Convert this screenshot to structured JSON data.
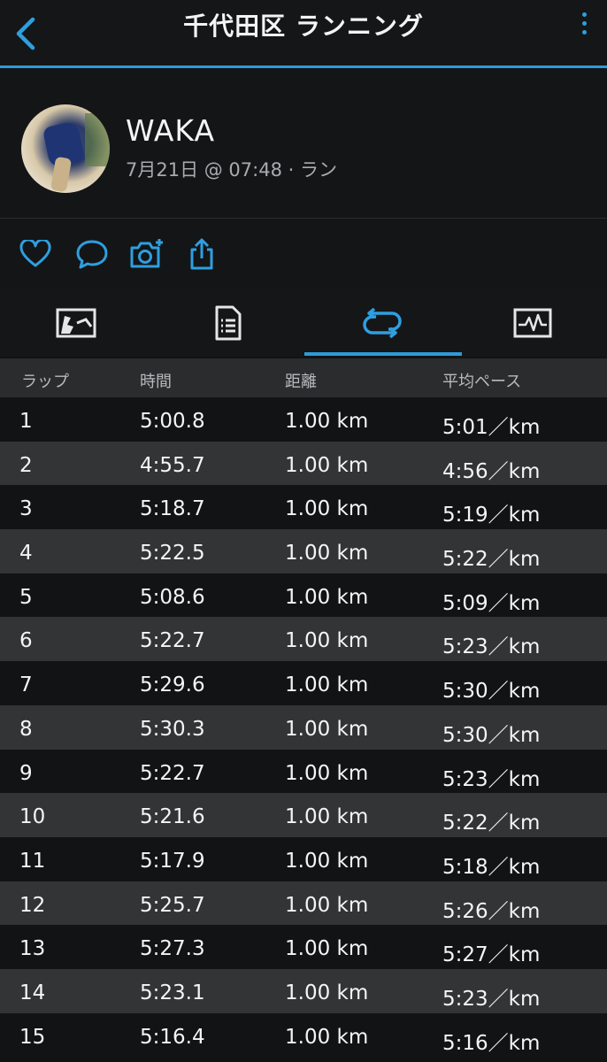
{
  "header": {
    "title": "千代田区 ランニング"
  },
  "profile": {
    "name": "WAKA",
    "meta": "7月21日 @ 07:48 · ラン"
  },
  "table": {
    "headers": {
      "lap": "ラップ",
      "time": "時間",
      "distance": "距離",
      "pace": "平均ペース"
    },
    "rows": [
      {
        "lap": "1",
        "time": "5:00.8",
        "distance": "1.00 km",
        "pace": "5:01／km"
      },
      {
        "lap": "2",
        "time": "4:55.7",
        "distance": "1.00 km",
        "pace": "4:56／km"
      },
      {
        "lap": "3",
        "time": "5:18.7",
        "distance": "1.00 km",
        "pace": "5:19／km"
      },
      {
        "lap": "4",
        "time": "5:22.5",
        "distance": "1.00 km",
        "pace": "5:22／km"
      },
      {
        "lap": "5",
        "time": "5:08.6",
        "distance": "1.00 km",
        "pace": "5:09／km"
      },
      {
        "lap": "6",
        "time": "5:22.7",
        "distance": "1.00 km",
        "pace": "5:23／km"
      },
      {
        "lap": "7",
        "time": "5:29.6",
        "distance": "1.00 km",
        "pace": "5:30／km"
      },
      {
        "lap": "8",
        "time": "5:30.3",
        "distance": "1.00 km",
        "pace": "5:30／km"
      },
      {
        "lap": "9",
        "time": "5:22.7",
        "distance": "1.00 km",
        "pace": "5:23／km"
      },
      {
        "lap": "10",
        "time": "5:21.6",
        "distance": "1.00 km",
        "pace": "5:22／km"
      },
      {
        "lap": "11",
        "time": "5:17.9",
        "distance": "1.00 km",
        "pace": "5:18／km"
      },
      {
        "lap": "12",
        "time": "5:25.7",
        "distance": "1.00 km",
        "pace": "5:26／km"
      },
      {
        "lap": "13",
        "time": "5:27.3",
        "distance": "1.00 km",
        "pace": "5:27／km"
      },
      {
        "lap": "14",
        "time": "5:23.1",
        "distance": "1.00 km",
        "pace": "5:23／km"
      },
      {
        "lap": "15",
        "time": "5:16.4",
        "distance": "1.00 km",
        "pace": "5:16／km"
      }
    ]
  },
  "icons": {
    "back": "chevron-left-icon",
    "more": "more-vertical-icon",
    "like": "heart-icon",
    "comment": "comment-icon",
    "photo": "camera-plus-icon",
    "share": "share-icon",
    "tab_overview": "map-icon",
    "tab_stats": "document-icon",
    "tab_laps": "laps-icon",
    "tab_charts": "chart-icon"
  },
  "colors": {
    "accent": "#2d9bd8",
    "background": "#111213",
    "row_alt": "#333436"
  }
}
